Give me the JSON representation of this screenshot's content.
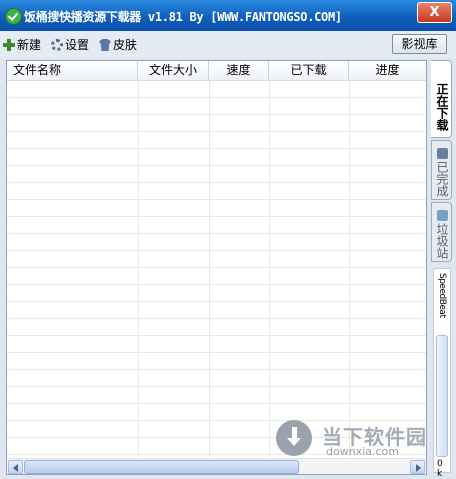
{
  "window": {
    "title": "饭桶搜快播资源下载器 v1.81 By [WWW.FANTONGSO.COM]",
    "close_glyph": "X"
  },
  "toolbar": {
    "new_label": "新建",
    "settings_label": "设置",
    "skin_label": "皮肤",
    "library_label": "影视库"
  },
  "table": {
    "columns": [
      "文件名称",
      "文件大小",
      "速度",
      "已下载",
      "进度"
    ],
    "rows": []
  },
  "side_tabs": [
    {
      "label": "正在下载",
      "active": true
    },
    {
      "label": "已完成",
      "active": false
    },
    {
      "label": "垃圾站",
      "active": false
    }
  ],
  "side_strip": {
    "text": "SpeedBeat",
    "bottom": "0 k"
  },
  "watermark": {
    "line1": "当下软件园",
    "line2": "downxia.com"
  }
}
